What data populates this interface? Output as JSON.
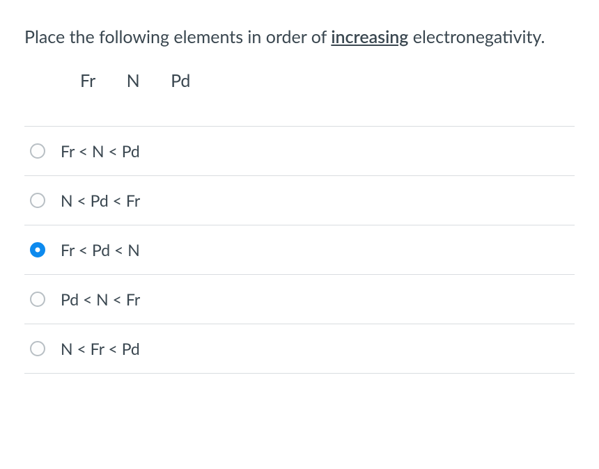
{
  "question": {
    "prefix": "Place the following elements in order of ",
    "emphasis": "increasing",
    "suffix": " electronegativity."
  },
  "elements": [
    "Fr",
    "N",
    "Pd"
  ],
  "options": [
    {
      "label": "Fr < N < Pd",
      "selected": false
    },
    {
      "label": "N < Pd < Fr",
      "selected": false
    },
    {
      "label": "Fr < Pd < N",
      "selected": true
    },
    {
      "label": "Pd < N < Fr",
      "selected": false
    },
    {
      "label": "N < Fr < Pd",
      "selected": false
    }
  ]
}
